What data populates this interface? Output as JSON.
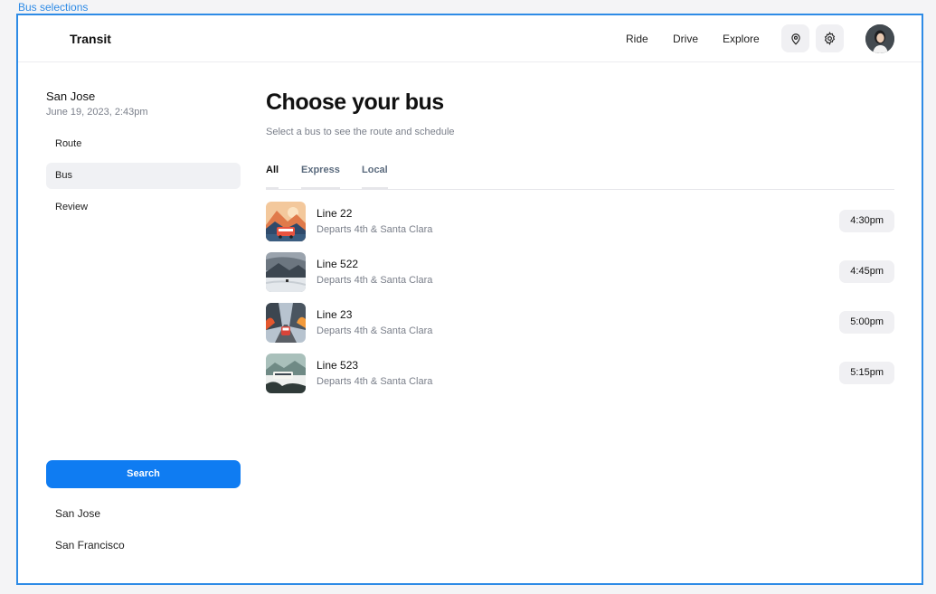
{
  "frame_label": "Bus selections",
  "header": {
    "brand": "Transit",
    "nav": [
      "Ride",
      "Drive",
      "Explore"
    ],
    "icons": [
      "location-pin-icon",
      "gear-icon"
    ]
  },
  "sidebar": {
    "city": "San Jose",
    "datetime": "June 19, 2023, 2:43pm",
    "items": [
      {
        "label": "Route",
        "active": false
      },
      {
        "label": "Bus",
        "active": true
      },
      {
        "label": "Review",
        "active": false
      }
    ],
    "search_label": "Search",
    "locations": [
      "San Jose",
      "San Francisco"
    ]
  },
  "main": {
    "title": "Choose your bus",
    "subtitle": "Select a bus to see the route and schedule",
    "tabs": [
      {
        "label": "All",
        "active": true
      },
      {
        "label": "Express",
        "active": false
      },
      {
        "label": "Local",
        "active": false
      }
    ],
    "buses": [
      {
        "name": "Line 22",
        "depart": "Departs 4th & Santa Clara",
        "time": "4:30pm"
      },
      {
        "name": "Line 522",
        "depart": "Departs 4th & Santa Clara",
        "time": "4:45pm"
      },
      {
        "name": "Line 23",
        "depart": "Departs 4th & Santa Clara",
        "time": "5:00pm"
      },
      {
        "name": "Line 523",
        "depart": "Departs 4th & Santa Clara",
        "time": "5:15pm"
      }
    ]
  },
  "colors": {
    "accent": "#0f7cf2",
    "frame_border": "#2e8be6"
  }
}
